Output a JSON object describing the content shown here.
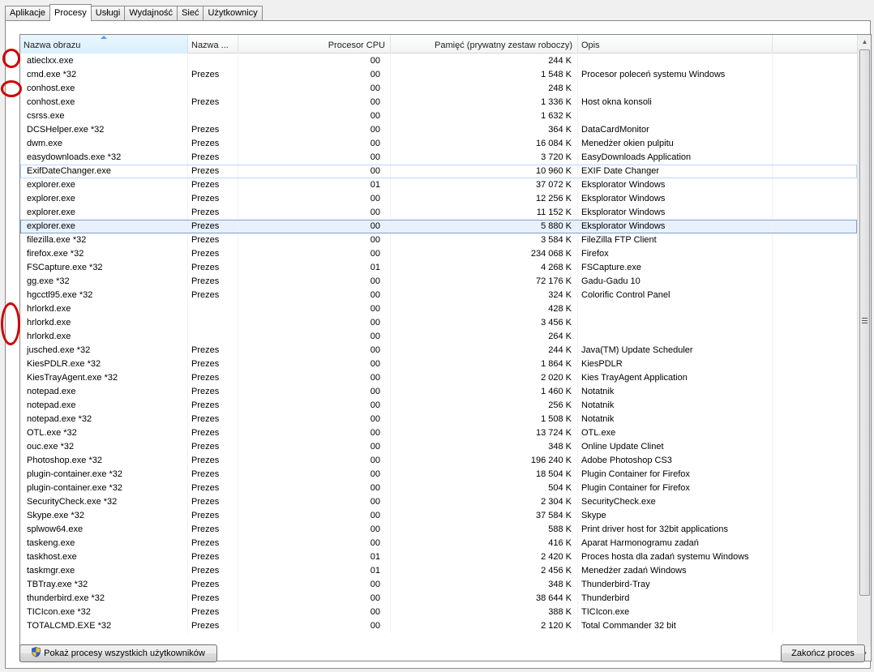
{
  "tabs": [
    "Aplikacje",
    "Procesy",
    "Usługi",
    "Wydajność",
    "Sieć",
    "Użytkownicy"
  ],
  "active_tab": 1,
  "columns": [
    "Nazwa obrazu",
    "Nazwa ...",
    "Procesor CPU",
    "Pamięć (prywatny zestaw roboczy)",
    "Opis"
  ],
  "sorted_column": 0,
  "processes": [
    {
      "name": "atieclxx.exe",
      "user": "",
      "cpu": "00",
      "mem": "244 K",
      "desc": ""
    },
    {
      "name": "cmd.exe *32",
      "user": "Prezes",
      "cpu": "00",
      "mem": "1 548 K",
      "desc": "Procesor poleceń systemu Windows"
    },
    {
      "name": "conhost.exe",
      "user": "",
      "cpu": "00",
      "mem": "248 K",
      "desc": ""
    },
    {
      "name": "conhost.exe",
      "user": "Prezes",
      "cpu": "00",
      "mem": "1 336 K",
      "desc": "Host okna konsoli"
    },
    {
      "name": "csrss.exe",
      "user": "",
      "cpu": "00",
      "mem": "1 632 K",
      "desc": ""
    },
    {
      "name": "DCSHelper.exe *32",
      "user": "Prezes",
      "cpu": "00",
      "mem": "364 K",
      "desc": "DataCardMonitor"
    },
    {
      "name": "dwm.exe",
      "user": "Prezes",
      "cpu": "00",
      "mem": "16 084 K",
      "desc": "Menedżer okien pulpitu"
    },
    {
      "name": "easydownloads.exe *32",
      "user": "Prezes",
      "cpu": "00",
      "mem": "3 720 K",
      "desc": "EasyDownloads Application"
    },
    {
      "name": "ExifDateChanger.exe",
      "user": "Prezes",
      "cpu": "00",
      "mem": "10 960 K",
      "desc": "EXIF Date Changer"
    },
    {
      "name": "explorer.exe",
      "user": "Prezes",
      "cpu": "01",
      "mem": "37 072 K",
      "desc": "Eksplorator Windows"
    },
    {
      "name": "explorer.exe",
      "user": "Prezes",
      "cpu": "00",
      "mem": "12 256 K",
      "desc": "Eksplorator Windows"
    },
    {
      "name": "explorer.exe",
      "user": "Prezes",
      "cpu": "00",
      "mem": "11 152 K",
      "desc": "Eksplorator Windows"
    },
    {
      "name": "explorer.exe",
      "user": "Prezes",
      "cpu": "00",
      "mem": "5 880 K",
      "desc": "Eksplorator Windows"
    },
    {
      "name": "filezilla.exe *32",
      "user": "Prezes",
      "cpu": "00",
      "mem": "3 584 K",
      "desc": "FileZilla FTP Client"
    },
    {
      "name": "firefox.exe *32",
      "user": "Prezes",
      "cpu": "00",
      "mem": "234 068 K",
      "desc": "Firefox"
    },
    {
      "name": "FSCapture.exe *32",
      "user": "Prezes",
      "cpu": "01",
      "mem": "4 268 K",
      "desc": "FSCapture.exe"
    },
    {
      "name": "gg.exe *32",
      "user": "Prezes",
      "cpu": "00",
      "mem": "72 176 K",
      "desc": "Gadu-Gadu 10"
    },
    {
      "name": "hgcctl95.exe *32",
      "user": "Prezes",
      "cpu": "00",
      "mem": "324 K",
      "desc": "Colorific Control Panel"
    },
    {
      "name": "hrlorkd.exe",
      "user": "",
      "cpu": "00",
      "mem": "428 K",
      "desc": ""
    },
    {
      "name": "hrlorkd.exe",
      "user": "",
      "cpu": "00",
      "mem": "3 456 K",
      "desc": ""
    },
    {
      "name": "hrlorkd.exe",
      "user": "",
      "cpu": "00",
      "mem": "264 K",
      "desc": ""
    },
    {
      "name": "jusched.exe *32",
      "user": "Prezes",
      "cpu": "00",
      "mem": "244 K",
      "desc": "Java(TM) Update Scheduler"
    },
    {
      "name": "KiesPDLR.exe *32",
      "user": "Prezes",
      "cpu": "00",
      "mem": "1 864 K",
      "desc": "KiesPDLR"
    },
    {
      "name": "KiesTrayAgent.exe *32",
      "user": "Prezes",
      "cpu": "00",
      "mem": "2 020 K",
      "desc": "Kies TrayAgent Application"
    },
    {
      "name": "notepad.exe",
      "user": "Prezes",
      "cpu": "00",
      "mem": "1 460 K",
      "desc": "Notatnik"
    },
    {
      "name": "notepad.exe",
      "user": "Prezes",
      "cpu": "00",
      "mem": "256 K",
      "desc": "Notatnik"
    },
    {
      "name": "notepad.exe *32",
      "user": "Prezes",
      "cpu": "00",
      "mem": "1 508 K",
      "desc": "Notatnik"
    },
    {
      "name": "OTL.exe *32",
      "user": "Prezes",
      "cpu": "00",
      "mem": "13 724 K",
      "desc": "OTL.exe"
    },
    {
      "name": "ouc.exe *32",
      "user": "Prezes",
      "cpu": "00",
      "mem": "348 K",
      "desc": "Online Update Clinet"
    },
    {
      "name": "Photoshop.exe *32",
      "user": "Prezes",
      "cpu": "00",
      "mem": "196 240 K",
      "desc": "Adobe Photoshop CS3"
    },
    {
      "name": "plugin-container.exe *32",
      "user": "Prezes",
      "cpu": "00",
      "mem": "18 504 K",
      "desc": "Plugin Container for Firefox"
    },
    {
      "name": "plugin-container.exe *32",
      "user": "Prezes",
      "cpu": "00",
      "mem": "504 K",
      "desc": "Plugin Container for Firefox"
    },
    {
      "name": "SecurityCheck.exe *32",
      "user": "Prezes",
      "cpu": "00",
      "mem": "2 304 K",
      "desc": "SecurityCheck.exe"
    },
    {
      "name": "Skype.exe *32",
      "user": "Prezes",
      "cpu": "00",
      "mem": "37 584 K",
      "desc": "Skype"
    },
    {
      "name": "splwow64.exe",
      "user": "Prezes",
      "cpu": "00",
      "mem": "588 K",
      "desc": "Print driver host for 32bit applications"
    },
    {
      "name": "taskeng.exe",
      "user": "Prezes",
      "cpu": "00",
      "mem": "416 K",
      "desc": "Aparat Harmonogramu zadań"
    },
    {
      "name": "taskhost.exe",
      "user": "Prezes",
      "cpu": "01",
      "mem": "2 420 K",
      "desc": "Proces hosta dla zadań systemu Windows"
    },
    {
      "name": "taskmgr.exe",
      "user": "Prezes",
      "cpu": "01",
      "mem": "2 456 K",
      "desc": "Menedżer zadań Windows"
    },
    {
      "name": "TBTray.exe *32",
      "user": "Prezes",
      "cpu": "00",
      "mem": "348 K",
      "desc": "Thunderbird-Tray"
    },
    {
      "name": "thunderbird.exe *32",
      "user": "Prezes",
      "cpu": "00",
      "mem": "38 644 K",
      "desc": "Thunderbird"
    },
    {
      "name": "TICIcon.exe *32",
      "user": "Prezes",
      "cpu": "00",
      "mem": "388 K",
      "desc": "TICIcon.exe"
    },
    {
      "name": "TOTALCMD.EXE *32",
      "user": "Prezes",
      "cpu": "00",
      "mem": "2 120 K",
      "desc": "Total Commander 32 bit"
    }
  ],
  "focused_row": 8,
  "selected_row": 12,
  "buttons": {
    "show_all": "Pokaż procesy wszystkich użytkowników",
    "end_process": "Zakończ proces"
  },
  "colors": {
    "annotation": "#d10000",
    "selection": "#e8f1fb",
    "selection_border": "#7da2ce"
  }
}
